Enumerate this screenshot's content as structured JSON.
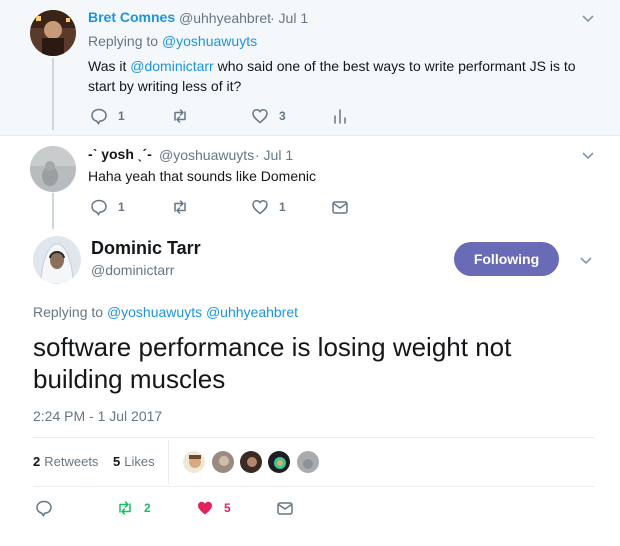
{
  "tweet1": {
    "name": "Bret Comnes",
    "handle": "@uhhyeahbret",
    "date": "· Jul 1",
    "replying_label": "Replying to",
    "replying_to": "@yoshuawuyts",
    "text_before": "Was it ",
    "text_mention": "@dominictarr",
    "text_after_line1": " who said one of the best ways to write performant JS is to",
    "text_line2": "start by writing less of it?",
    "replies": "1",
    "retweets": "",
    "likes": "3"
  },
  "tweet2": {
    "name": "-ˋ yosh ˎ´-",
    "handle": "@yoshuawuyts",
    "date": "· Jul 1",
    "text": "Haha yeah that sounds like Domenic",
    "replies": "1",
    "likes": "1"
  },
  "main": {
    "name": "Dominic Tarr",
    "handle": "@dominictarr",
    "follow_label": "Following",
    "replying_label": "Replying to",
    "replying_to": "@yoshuawuyts @uhhyeahbret",
    "text": "software performance is losing weight not building muscles",
    "timestamp": "2:24 PM - 1 Jul 2017",
    "retweet_count": "2",
    "retweet_label": "Retweets",
    "like_count": "5",
    "like_label": "Likes",
    "action_retweets": "2",
    "action_likes": "5"
  },
  "colors": {
    "link": "#1b95e0",
    "follow_button": "#6a6bb7",
    "retweet_green": "#17bf63",
    "like_red": "#e0245e",
    "muted": "#657786"
  },
  "icons": [
    "reply-icon",
    "retweet-icon",
    "heart-icon",
    "analytics-icon",
    "direct-message-icon",
    "chevron-down-icon"
  ]
}
